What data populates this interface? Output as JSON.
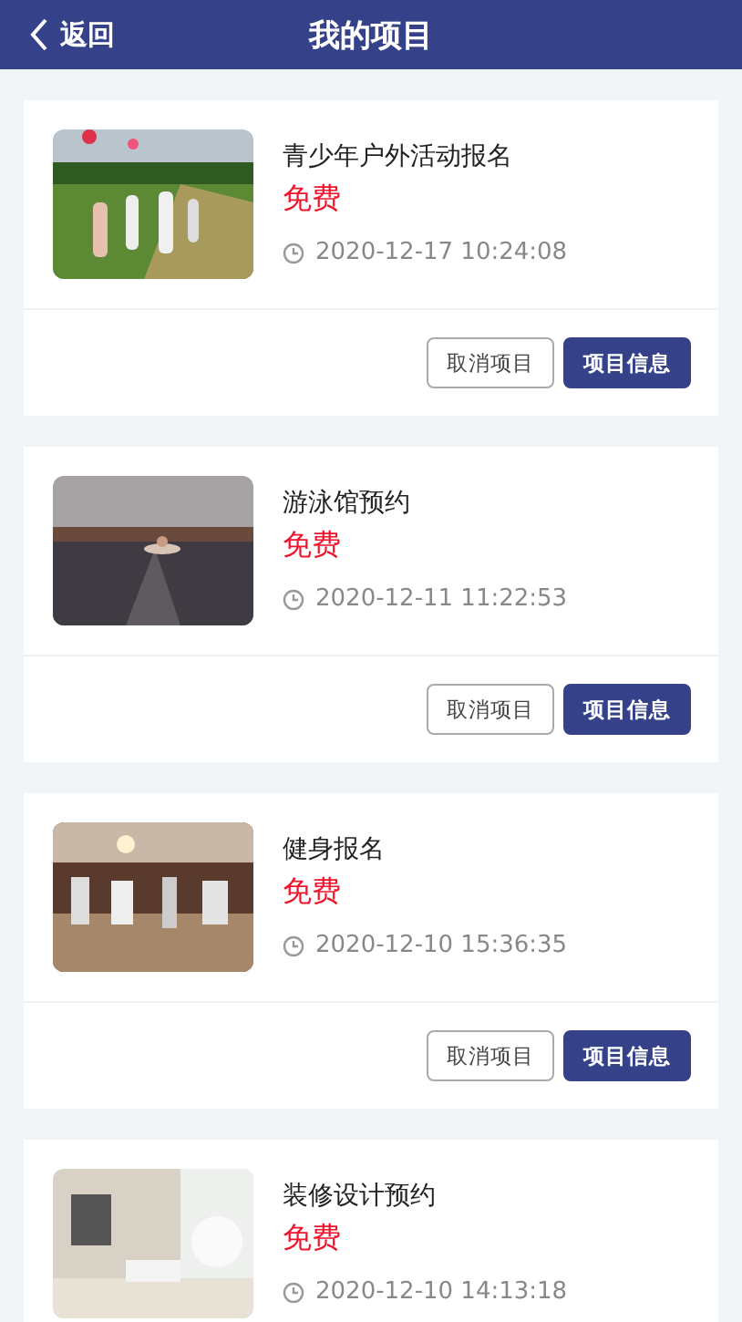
{
  "header": {
    "back": "返回",
    "title": "我的项目"
  },
  "projects": [
    {
      "title": "青少年户外活动报名",
      "price": "免费",
      "time": "2020-12-17 10:24:08",
      "actions": [
        "取消项目",
        "项目信息"
      ]
    },
    {
      "title": "游泳馆预约",
      "price": "免费",
      "time": "2020-12-11 11:22:53",
      "actions": [
        "取消项目",
        "项目信息"
      ]
    },
    {
      "title": "健身报名",
      "price": "免费",
      "time": "2020-12-10 15:36:35",
      "actions": [
        "取消项目",
        "项目信息"
      ]
    },
    {
      "title": "装修设计预约",
      "price": "免费",
      "time": "2020-12-10 14:13:18"
    }
  ]
}
